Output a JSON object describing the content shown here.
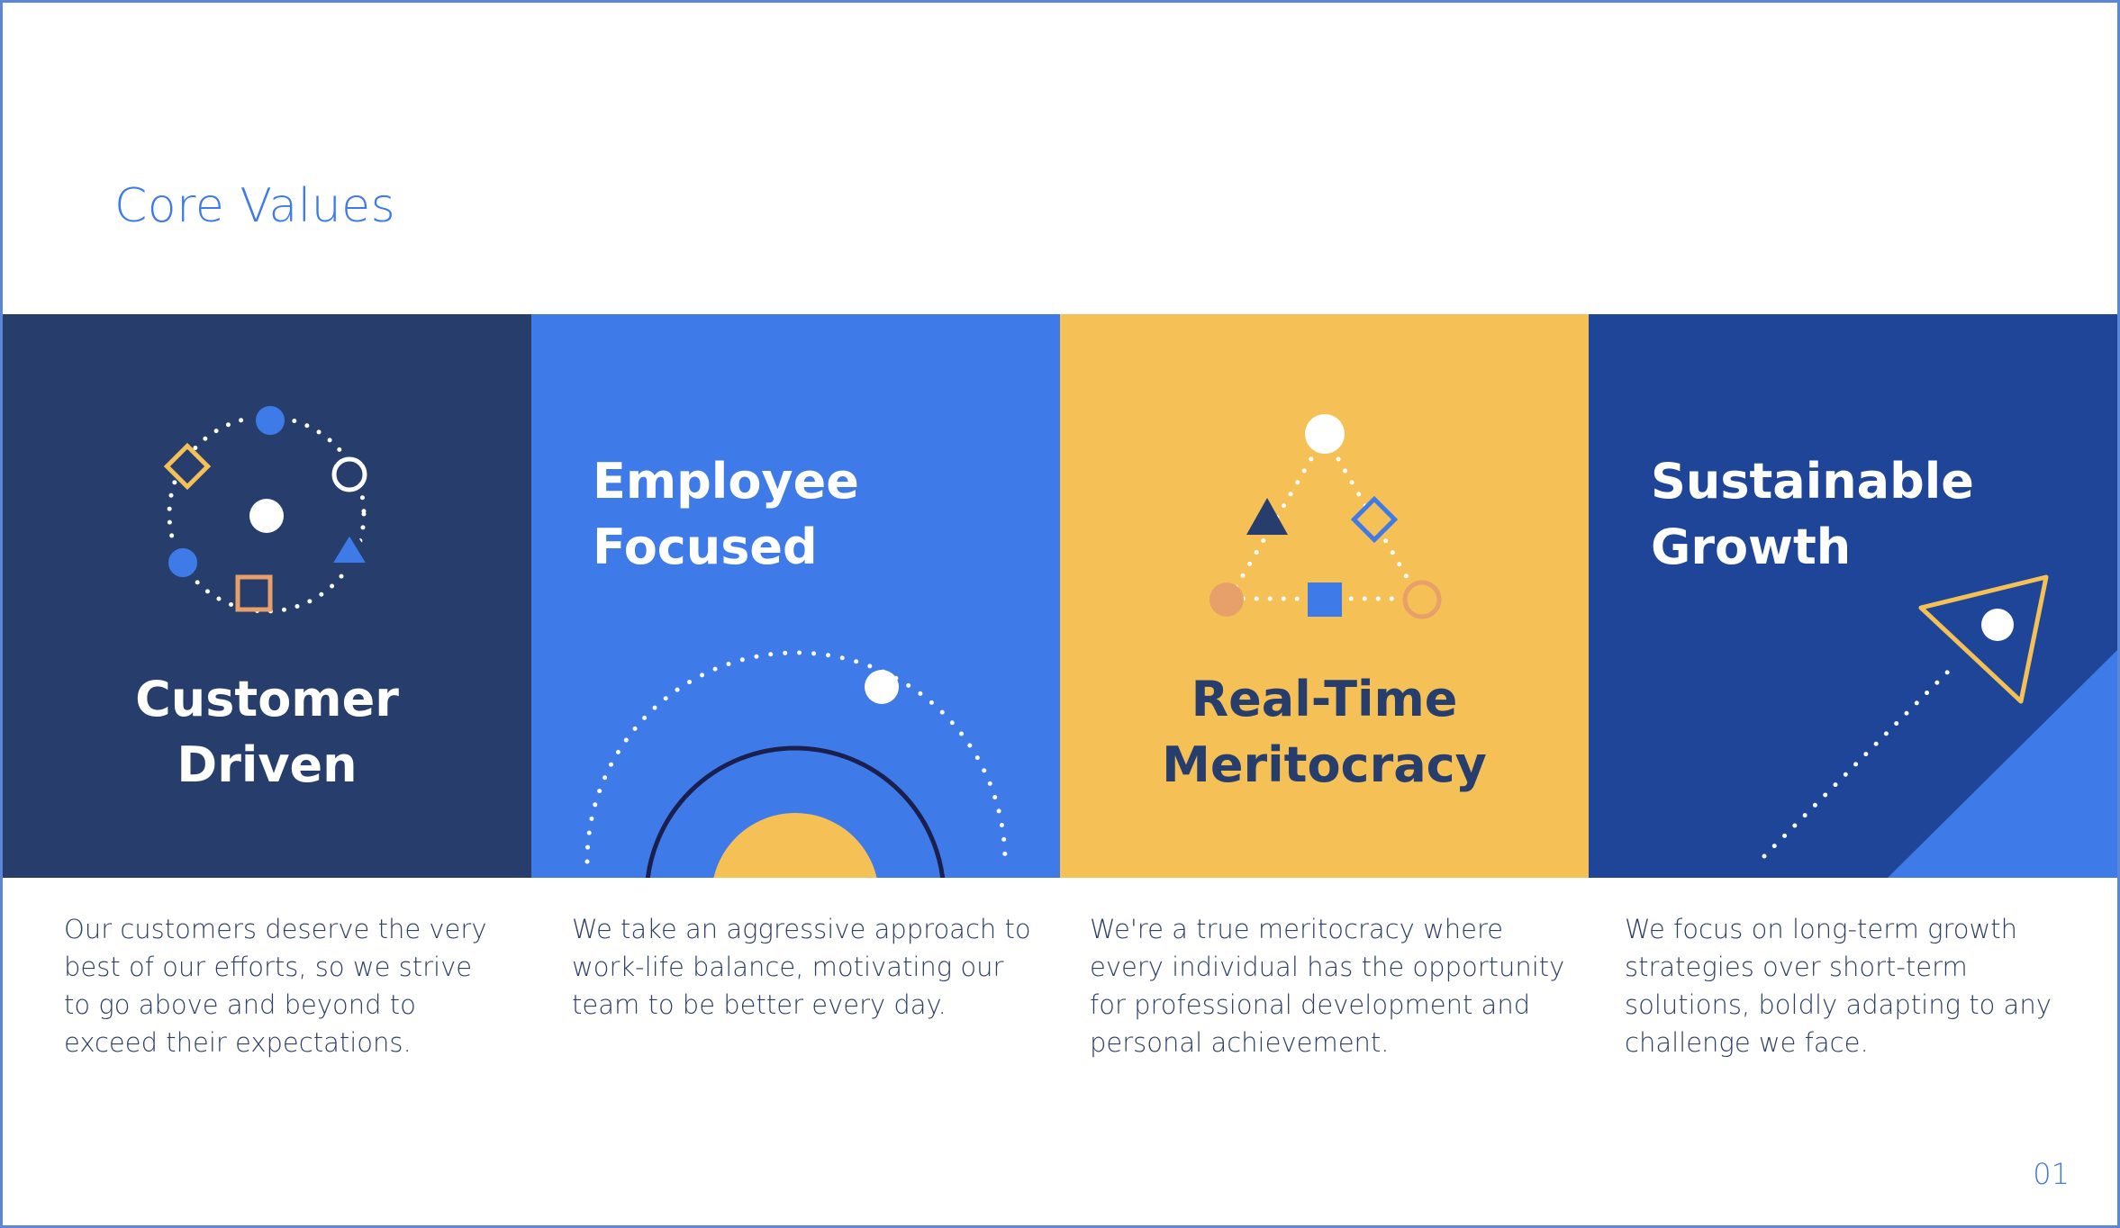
{
  "slide": {
    "title": "Core Values",
    "page_number": "01"
  },
  "colors": {
    "navy": "#273e6d",
    "blue": "#3f7be8",
    "yellow": "#f5c156",
    "royal": "#1e4598",
    "orange": "#e8a06a",
    "text": "#2e3f66"
  },
  "values": [
    {
      "title_line_1": "Customer",
      "title_line_2": "Driven",
      "description": "Our customers deserve the very best of our efforts, so we strive to go above and beyond to exceed their expectations.",
      "icons": [
        "circle-of-shapes-icon"
      ]
    },
    {
      "title_line_1": "Employee",
      "title_line_2": "Focused",
      "description": "We take an aggressive approach to work-life balance, motivating our team to be better every day.",
      "icons": [
        "rising-sun-orbit-icon"
      ]
    },
    {
      "title_line_1": "Real-Time",
      "title_line_2": "Meritocracy",
      "description": "We're a true meritocracy where every individual has the opportunity for professional development and personal achievement.",
      "icons": [
        "triangle-of-shapes-icon"
      ]
    },
    {
      "title_line_1": "Sustainable",
      "title_line_2": "Growth",
      "description": "We focus on long-term growth strategies over short-term solutions, boldly adapting to any challenge we face.",
      "icons": [
        "paper-plane-trajectory-icon"
      ]
    }
  ]
}
